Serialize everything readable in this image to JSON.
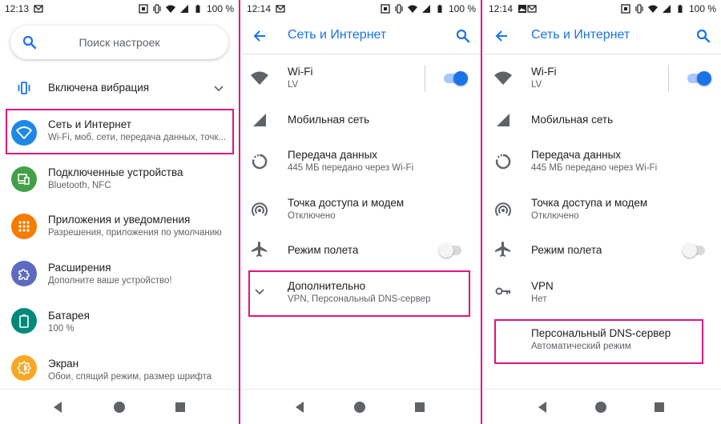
{
  "colors": {
    "accent": "#1a73e8",
    "highlight": "#e3147f",
    "toggle_on_track": "#a8c7fa",
    "toggle_on_thumb": "#1a73e8",
    "toggle_off_track": "#dadada",
    "toggle_off_thumb": "#f5f5f5",
    "icon_gray": "#5f6368"
  },
  "screen1": {
    "status": {
      "time": "12:13",
      "battery": "100 %"
    },
    "search": {
      "placeholder": "Поиск настроек"
    },
    "vibration": {
      "label": "Включена вибрация"
    },
    "items": [
      {
        "title": "Сеть и Интернет",
        "subtitle": "Wi-Fi, моб. сети, передача данных, точк...",
        "icon": "wifi-icon",
        "color": "#1e88e5"
      },
      {
        "title": "Подключенные устройства",
        "subtitle": "Bluetooth, NFC",
        "icon": "devices-icon",
        "color": "#43a047"
      },
      {
        "title": "Приложения и уведомления",
        "subtitle": "Разрешения, приложения по умолчанию",
        "icon": "apps-icon",
        "color": "#f57c00"
      },
      {
        "title": "Расширения",
        "subtitle": "Дополните ваше устройство!",
        "icon": "puzzle-icon",
        "color": "#5c6bc0"
      },
      {
        "title": "Батарея",
        "subtitle": "100 %",
        "icon": "battery-icon",
        "color": "#00897b"
      },
      {
        "title": "Экран",
        "subtitle": "Обои, спящий режим, размер шрифта",
        "icon": "brightness-icon",
        "color": "#f9a825"
      }
    ]
  },
  "screen2": {
    "status": {
      "time": "12:14",
      "battery": "100 %"
    },
    "title": "Сеть и Интернет",
    "items": {
      "wifi": {
        "title": "Wi-Fi",
        "subtitle": "LV",
        "toggle": "on"
      },
      "mobile": {
        "title": "Мобильная сеть"
      },
      "data": {
        "title": "Передача данных",
        "subtitle": "445 МБ передано через Wi-Fi"
      },
      "hotspot": {
        "title": "Точка доступа и модем",
        "subtitle": "Отключено"
      },
      "airplane": {
        "title": "Режим полета",
        "toggle": "off"
      },
      "advanced": {
        "title": "Дополнительно",
        "subtitle": "VPN, Персональный DNS-сервер"
      }
    }
  },
  "screen3": {
    "status": {
      "time": "12:14",
      "battery": "100 %"
    },
    "title": "Сеть и Интернет",
    "items": {
      "wifi": {
        "title": "Wi-Fi",
        "subtitle": "LV",
        "toggle": "on"
      },
      "mobile": {
        "title": "Мобильная сеть"
      },
      "data": {
        "title": "Передача данных",
        "subtitle": "445 МБ передано через Wi-Fi"
      },
      "hotspot": {
        "title": "Точка доступа и модем",
        "subtitle": "Отключено"
      },
      "airplane": {
        "title": "Режим полета",
        "toggle": "off"
      },
      "vpn": {
        "title": "VPN",
        "subtitle": "Нет"
      },
      "dns": {
        "title": "Персональный DNS-сервер",
        "subtitle": "Автоматический режим"
      }
    }
  }
}
